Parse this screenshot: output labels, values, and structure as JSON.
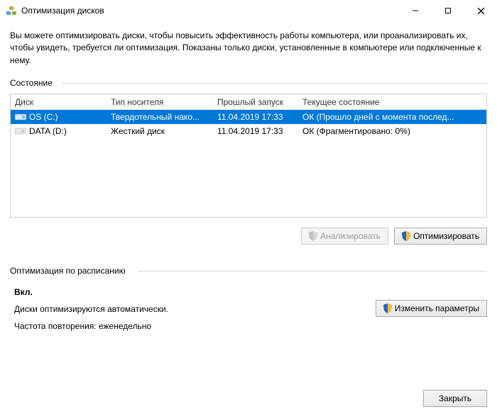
{
  "window": {
    "title": "Оптимизация дисков"
  },
  "intro": "Вы можете оптимизировать диски, чтобы повысить эффективность работы  компьютера, или проанализировать их, чтобы увидеть, требуется ли оптимизация. Показаны только диски, установленные в компьютере или подключенные к нему.",
  "status": {
    "group_label": "Состояние",
    "columns": {
      "c1": "Диск",
      "c2": "Тип носителя",
      "c3": "Прошлый запуск",
      "c4": "Текущее состояние"
    },
    "rows": [
      {
        "name": "OS (C:)",
        "media": "Твердотельный нако...",
        "last": "11.04.2019 17:33",
        "state": "ОК (Прошло дней с момента послед...",
        "selected": true,
        "icon": "ssd"
      },
      {
        "name": "DATA (D:)",
        "media": "Жесткий диск",
        "last": "11.04.2019 17:33",
        "state": "ОК (Фрагментировано: 0%)",
        "selected": false,
        "icon": "hdd"
      }
    ]
  },
  "buttons": {
    "analyze": "Анализировать",
    "optimize": "Оптимизировать",
    "change_settings": "Изменить параметры",
    "close": "Закрыть"
  },
  "schedule": {
    "group_label": "Оптимизация по расписанию",
    "status_on": "Вкл.",
    "auto_text": "Диски оптимизируются автоматически.",
    "freq_text": "Частота повторения: еженедельно"
  }
}
